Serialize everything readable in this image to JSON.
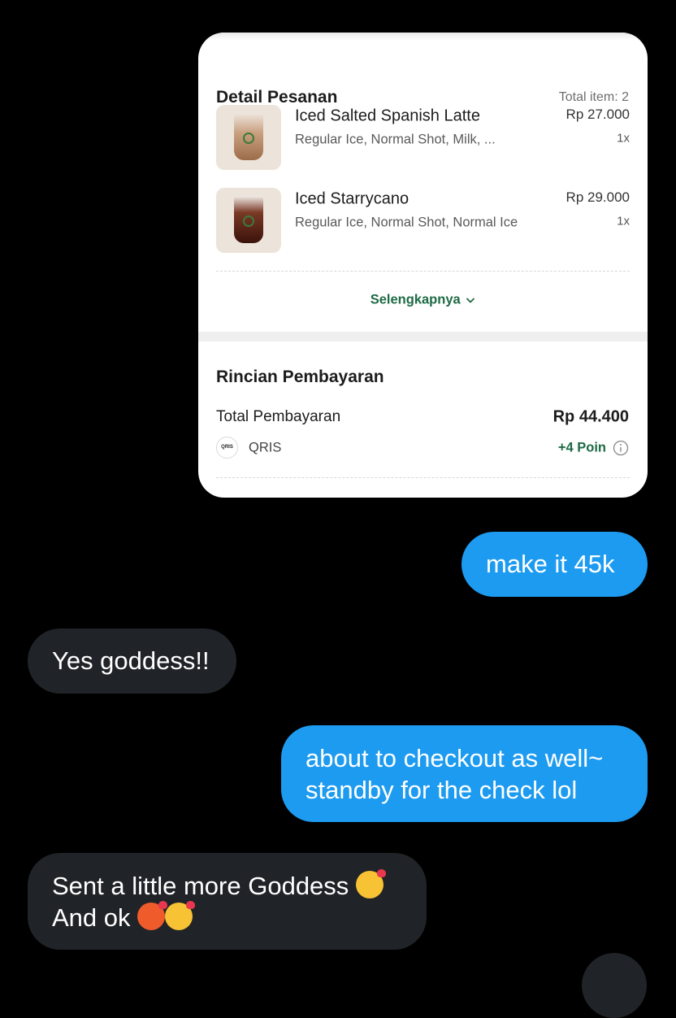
{
  "order_card": {
    "title": "Detail Pesanan",
    "total_items": "Total item: 2",
    "items": [
      {
        "name": "Iced Salted Spanish Latte",
        "options": "Regular Ice, Normal Shot, Milk, ...",
        "price": "Rp 27.000",
        "quantity": "1x"
      },
      {
        "name": "Iced Starrycano",
        "options": "Regular Ice, Normal Shot, Normal Ice",
        "price": "Rp 29.000",
        "quantity": "1x"
      }
    ],
    "see_more": "Selengkapnya",
    "payment": {
      "title": "Rincian Pembayaran",
      "total_label": "Total Pembayaran",
      "total_amount": "Rp 44.400",
      "method": "QRIS",
      "method_icon_text": "QRIS",
      "points": "+4 Poin"
    }
  },
  "messages": [
    {
      "direction": "outgoing",
      "lines": [
        "make it 45k"
      ]
    },
    {
      "direction": "incoming",
      "lines": [
        "Yes goddess!!"
      ]
    },
    {
      "direction": "outgoing",
      "lines": [
        "about to checkout as well~",
        "standby for the check lol"
      ]
    },
    {
      "direction": "incoming",
      "lines": [
        "Sent a little more Goddess",
        "And ok"
      ],
      "emojis": [
        "smiling-face-with-hearts",
        "hot-face",
        "smiling-face-with-hearts"
      ]
    }
  ],
  "colors": {
    "background": "#000000",
    "outgoing_bubble": "#1d9bf0",
    "incoming_bubble": "#202327",
    "brand_green": "#1e6a44"
  }
}
